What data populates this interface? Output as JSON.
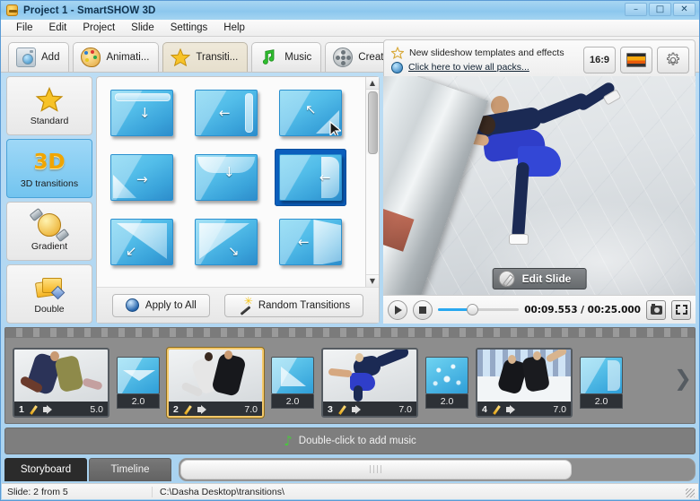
{
  "window": {
    "title": "Project 1 - SmartSHOW 3D",
    "icon": "app-icon",
    "buttons": {
      "minimize": "–",
      "maximize": "□",
      "close": "✕"
    }
  },
  "menu": {
    "items": [
      "File",
      "Edit",
      "Project",
      "Slide",
      "Settings",
      "Help"
    ]
  },
  "toolbar": {
    "tabs": [
      {
        "label": "Add",
        "icon": "camera-icon",
        "active": false
      },
      {
        "label": "Animati...",
        "icon": "palette-icon",
        "active": false
      },
      {
        "label": "Transiti...",
        "icon": "star-icon",
        "active": true
      },
      {
        "label": "Music",
        "icon": "music-note-icon",
        "active": false
      },
      {
        "label": "Create",
        "icon": "film-reel-icon",
        "active": false
      }
    ]
  },
  "promo": {
    "line1": "New slideshow templates and effects",
    "line2": "Click here to view all packs...",
    "aspect_label": "16:9",
    "skin_icon": "sunset-image-icon",
    "settings_icon": "gear-icon"
  },
  "categories": [
    {
      "label": "Standard",
      "icon": "star-icon",
      "active": false
    },
    {
      "label": "3D transitions",
      "icon": "3d-icon",
      "active": true,
      "glyph": "3D"
    },
    {
      "label": "Gradient",
      "icon": "gradient-icon",
      "active": false
    },
    {
      "label": "Double",
      "icon": "double-icon",
      "active": false
    }
  ],
  "transitions": {
    "items": [
      {
        "name": "blind-down",
        "arrow": "↓",
        "selected": false
      },
      {
        "name": "roll-left",
        "arrow": "←",
        "selected": false
      },
      {
        "name": "page-peel-corner",
        "arrow": "↖",
        "selected": false
      },
      {
        "name": "page-peel-left",
        "arrow": "→",
        "selected": false
      },
      {
        "name": "curtain-down",
        "arrow": "↓",
        "selected": false
      },
      {
        "name": "door-open-left",
        "arrow": "←",
        "selected": true
      },
      {
        "name": "fold-corner-up",
        "arrow": "↙",
        "selected": false
      },
      {
        "name": "fold-diagonal",
        "arrow": "↘",
        "selected": false
      },
      {
        "name": "swing-door",
        "arrow": "←",
        "selected": false
      }
    ],
    "apply_all_label": "Apply to All",
    "random_label": "Random Transitions",
    "scroll_up": "▲",
    "scroll_down": "▼"
  },
  "preview": {
    "edit_slide_label": "Edit Slide",
    "play_icon": "play-icon",
    "stop_icon": "stop-icon",
    "time": "00:09.553 / 00:25.000",
    "seek_percent": 42,
    "snapshot_icon": "camera-icon",
    "fullscreen_icon": "fullscreen-icon"
  },
  "storyboard": {
    "slides": [
      {
        "number": "1",
        "duration": "5.0",
        "selected": false
      },
      {
        "number": "2",
        "duration": "7.0",
        "selected": true
      },
      {
        "number": "3",
        "duration": "7.0",
        "selected": false
      },
      {
        "number": "4",
        "duration": "7.0",
        "selected": false
      }
    ],
    "transitions": [
      {
        "duration": "2.0",
        "name": "transition-chip"
      },
      {
        "duration": "2.0",
        "name": "transition-chip"
      },
      {
        "duration": "2.0",
        "name": "transition-chip"
      },
      {
        "duration": "2.0",
        "name": "transition-chip"
      }
    ],
    "next_arrow": "❯"
  },
  "music": {
    "label": "Double-click to add music",
    "icon": "music-note-icon"
  },
  "bottom_tabs": [
    {
      "label": "Storyboard",
      "active": true
    },
    {
      "label": "Timeline",
      "active": false
    }
  ],
  "status": {
    "slide_info": "Slide: 2 from 5",
    "path": "C:\\Dasha Desktop\\transitions\\"
  },
  "colors": {
    "accent": "#29a8f0",
    "selection": "#0b5fbd",
    "slide_selected": "#f4c96a",
    "panel": "#e8e8e8"
  }
}
